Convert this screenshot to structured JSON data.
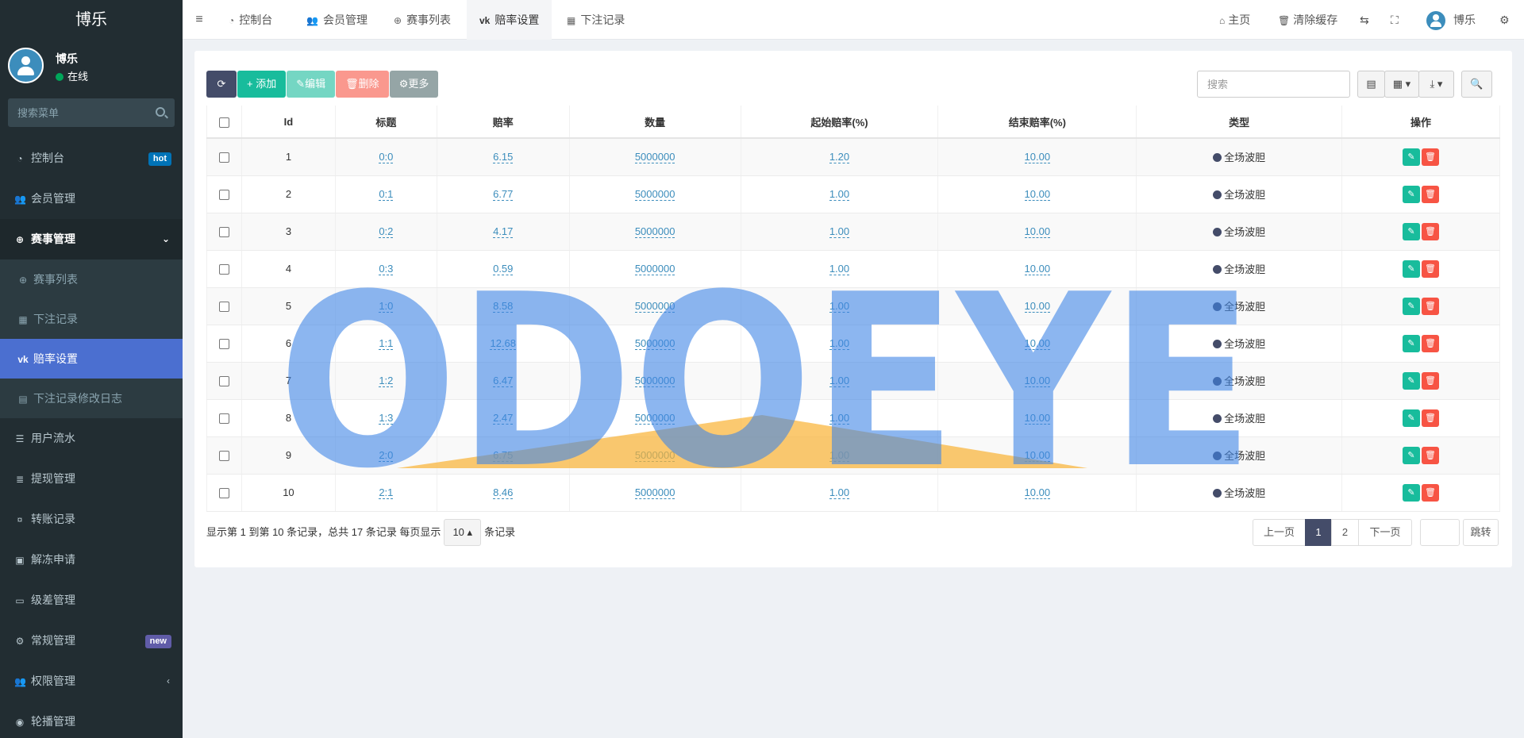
{
  "app": {
    "logo": "博乐",
    "username": "博乐",
    "status": "在线"
  },
  "sidebar": {
    "search_placeholder": "搜索菜单",
    "items": [
      {
        "label": "控制台",
        "icon": "dashboard-icon",
        "badge": "hot",
        "badge_color": "#0073b7"
      },
      {
        "label": "会员管理",
        "icon": "users-icon"
      },
      {
        "label": "赛事管理",
        "icon": "lifebuoy-icon"
      },
      {
        "label": "用户流水",
        "icon": "list-icon"
      },
      {
        "label": "提现管理",
        "icon": "list-alt-icon"
      },
      {
        "label": "转账记录",
        "icon": "money-icon"
      },
      {
        "label": "解冻申请",
        "icon": "picture-icon"
      },
      {
        "label": "级差管理",
        "icon": "window-icon"
      },
      {
        "label": "常规管理",
        "icon": "cogs-icon",
        "badge": "new",
        "badge_color": "#605ca8"
      },
      {
        "label": "权限管理",
        "icon": "users-icon"
      },
      {
        "label": "轮播管理",
        "icon": "image-icon"
      }
    ],
    "submenu": [
      {
        "label": "赛事列表",
        "icon": "lifebuoy-icon"
      },
      {
        "label": "下注记录",
        "icon": "calendar-icon"
      },
      {
        "label": "赔率设置",
        "icon": "vk-icon"
      },
      {
        "label": "下注记录修改日志",
        "icon": "table-icon"
      }
    ]
  },
  "topnav": {
    "tabs": [
      {
        "label": "控制台",
        "icon": "dashboard-icon"
      },
      {
        "label": "会员管理",
        "icon": "users-icon"
      },
      {
        "label": "赛事列表",
        "icon": "lifebuoy-icon"
      },
      {
        "label": "赔率设置",
        "icon": "vk-icon"
      },
      {
        "label": "下注记录",
        "icon": "calendar-icon"
      }
    ],
    "home": "主页",
    "clear_cache": "清除缓存",
    "user": "博乐"
  },
  "toolbar": {
    "add": "添加",
    "edit": "编辑",
    "delete": "删除",
    "more": "更多",
    "search_placeholder": "搜索"
  },
  "table": {
    "columns": [
      "Id",
      "标题",
      "赔率",
      "数量",
      "起始赔率(%)",
      "结束赔率(%)",
      "类型",
      "操作"
    ],
    "rows": [
      {
        "id": "1",
        "title": "0:0",
        "odds": "6.15",
        "qty": "5000000",
        "start": "1.20",
        "end": "10.00",
        "type": "全场波胆"
      },
      {
        "id": "2",
        "title": "0:1",
        "odds": "6.77",
        "qty": "5000000",
        "start": "1.00",
        "end": "10.00",
        "type": "全场波胆"
      },
      {
        "id": "3",
        "title": "0:2",
        "odds": "4.17",
        "qty": "5000000",
        "start": "1.00",
        "end": "10.00",
        "type": "全场波胆"
      },
      {
        "id": "4",
        "title": "0:3",
        "odds": "0.59",
        "qty": "5000000",
        "start": "1.00",
        "end": "10.00",
        "type": "全场波胆"
      },
      {
        "id": "5",
        "title": "1:0",
        "odds": "8.58",
        "qty": "5000000",
        "start": "1.00",
        "end": "10.00",
        "type": "全场波胆"
      },
      {
        "id": "6",
        "title": "1:1",
        "odds": "12.68",
        "qty": "5000000",
        "start": "1.00",
        "end": "10.00",
        "type": "全场波胆"
      },
      {
        "id": "7",
        "title": "1:2",
        "odds": "6.47",
        "qty": "5000000",
        "start": "1.00",
        "end": "10.00",
        "type": "全场波胆"
      },
      {
        "id": "8",
        "title": "1:3",
        "odds": "2.47",
        "qty": "5000000",
        "start": "1.00",
        "end": "10.00",
        "type": "全场波胆"
      },
      {
        "id": "9",
        "title": "2:0",
        "odds": "6.75",
        "qty": "5000000",
        "start": "1.00",
        "end": "10.00",
        "type": "全场波胆"
      },
      {
        "id": "10",
        "title": "2:1",
        "odds": "8.46",
        "qty": "5000000",
        "start": "1.00",
        "end": "10.00",
        "type": "全场波胆"
      }
    ]
  },
  "pagination": {
    "info": "显示第 1 到第 10 条记录，总共 17 条记录 每页显示",
    "page_size": "10",
    "suffix": "条记录",
    "prev": "上一页",
    "pages": [
      "1",
      "2"
    ],
    "next": "下一页",
    "jump": "跳转"
  },
  "watermark": {
    "text": "ODOEYE"
  },
  "colors": {
    "sidebar_bg": "#222d32",
    "active_item": "#4b6fd0",
    "success": "#18bc9c",
    "danger": "#f75444",
    "primary_dark": "#444c69"
  }
}
